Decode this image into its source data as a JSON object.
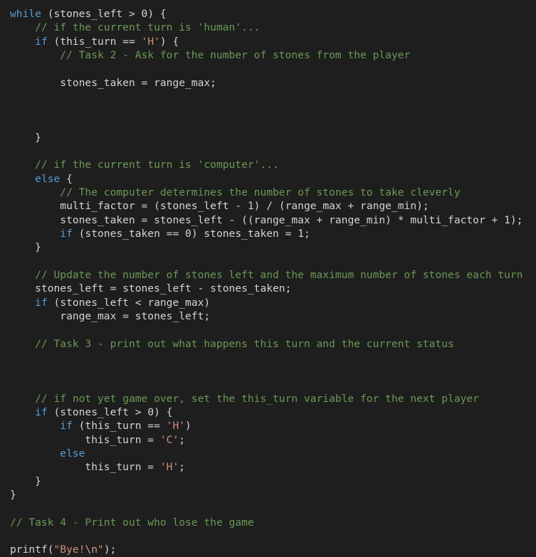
{
  "editor": {
    "language": "c",
    "theme": "dark-plus",
    "background_color": "#1e1e1e",
    "default_text_color": "#d4d4d4",
    "keyword_color": "#569cd6",
    "comment_color": "#6a9955",
    "string_color": "#ce9178",
    "escape_color": "#d7a58e",
    "font_size_px": 14.6,
    "line_height_px": 19.32,
    "indent_spaces": 4
  },
  "lines": [
    {
      "n": 1,
      "tokens": [
        {
          "t": "key",
          "s": "while"
        },
        {
          "t": "def",
          "s": " (stones_left > "
        },
        {
          "t": "num",
          "s": "0"
        },
        {
          "t": "def",
          "s": ") {"
        }
      ]
    },
    {
      "n": 2,
      "tokens": [
        {
          "t": "com",
          "s": "    // if the current turn is 'human'..."
        }
      ]
    },
    {
      "n": 3,
      "tokens": [
        {
          "t": "def",
          "s": "    "
        },
        {
          "t": "key",
          "s": "if"
        },
        {
          "t": "def",
          "s": " (this_turn == "
        },
        {
          "t": "str",
          "s": "'H'"
        },
        {
          "t": "def",
          "s": ") {"
        }
      ]
    },
    {
      "n": 4,
      "tokens": [
        {
          "t": "com",
          "s": "        // Task 2 - Ask for the number of stones from the player"
        }
      ]
    },
    {
      "n": 5,
      "tokens": []
    },
    {
      "n": 6,
      "tokens": [
        {
          "t": "def",
          "s": "        stones_taken = range_max;"
        }
      ]
    },
    {
      "n": 7,
      "tokens": []
    },
    {
      "n": 8,
      "tokens": []
    },
    {
      "n": 9,
      "tokens": []
    },
    {
      "n": 10,
      "tokens": [
        {
          "t": "def",
          "s": "    }"
        }
      ]
    },
    {
      "n": 11,
      "tokens": []
    },
    {
      "n": 12,
      "tokens": [
        {
          "t": "com",
          "s": "    // if the current turn is 'computer'..."
        }
      ]
    },
    {
      "n": 13,
      "tokens": [
        {
          "t": "def",
          "s": "    "
        },
        {
          "t": "key",
          "s": "else"
        },
        {
          "t": "def",
          "s": " {"
        }
      ]
    },
    {
      "n": 14,
      "tokens": [
        {
          "t": "com",
          "s": "        // The computer determines the number of stones to take cleverly"
        }
      ]
    },
    {
      "n": 15,
      "tokens": [
        {
          "t": "def",
          "s": "        multi_factor = (stones_left - "
        },
        {
          "t": "num",
          "s": "1"
        },
        {
          "t": "def",
          "s": ") / (range_max + range_min);"
        }
      ]
    },
    {
      "n": 16,
      "tokens": [
        {
          "t": "def",
          "s": "        stones_taken = stones_left - ((range_max + range_min) * multi_factor + "
        },
        {
          "t": "num",
          "s": "1"
        },
        {
          "t": "def",
          "s": ");"
        }
      ]
    },
    {
      "n": 17,
      "tokens": [
        {
          "t": "def",
          "s": "        "
        },
        {
          "t": "key",
          "s": "if"
        },
        {
          "t": "def",
          "s": " (stones_taken == "
        },
        {
          "t": "num",
          "s": "0"
        },
        {
          "t": "def",
          "s": ") stones_taken = "
        },
        {
          "t": "num",
          "s": "1"
        },
        {
          "t": "def",
          "s": ";"
        }
      ]
    },
    {
      "n": 18,
      "tokens": [
        {
          "t": "def",
          "s": "    }"
        }
      ]
    },
    {
      "n": 19,
      "tokens": []
    },
    {
      "n": 20,
      "tokens": [
        {
          "t": "com",
          "s": "    // Update the number of stones left and the maximum number of stones each turn"
        }
      ]
    },
    {
      "n": 21,
      "tokens": [
        {
          "t": "def",
          "s": "    stones_left = stones_left - stones_taken;"
        }
      ]
    },
    {
      "n": 22,
      "tokens": [
        {
          "t": "def",
          "s": "    "
        },
        {
          "t": "key",
          "s": "if"
        },
        {
          "t": "def",
          "s": " (stones_left < range_max)"
        }
      ]
    },
    {
      "n": 23,
      "tokens": [
        {
          "t": "def",
          "s": "        range_max = stones_left;"
        }
      ]
    },
    {
      "n": 24,
      "tokens": []
    },
    {
      "n": 25,
      "tokens": [
        {
          "t": "com",
          "s": "    // Task 3 - print out what happens this turn and the current status"
        }
      ]
    },
    {
      "n": 26,
      "tokens": []
    },
    {
      "n": 27,
      "tokens": []
    },
    {
      "n": 28,
      "tokens": []
    },
    {
      "n": 29,
      "tokens": [
        {
          "t": "com",
          "s": "    // if not yet game over, set the this_turn variable for the next player"
        }
      ]
    },
    {
      "n": 30,
      "tokens": [
        {
          "t": "def",
          "s": "    "
        },
        {
          "t": "key",
          "s": "if"
        },
        {
          "t": "def",
          "s": " (stones_left > "
        },
        {
          "t": "num",
          "s": "0"
        },
        {
          "t": "def",
          "s": ") {"
        }
      ]
    },
    {
      "n": 31,
      "tokens": [
        {
          "t": "def",
          "s": "        "
        },
        {
          "t": "key",
          "s": "if"
        },
        {
          "t": "def",
          "s": " (this_turn == "
        },
        {
          "t": "str",
          "s": "'H'"
        },
        {
          "t": "def",
          "s": ")"
        }
      ]
    },
    {
      "n": 32,
      "tokens": [
        {
          "t": "def",
          "s": "            this_turn = "
        },
        {
          "t": "str",
          "s": "'C'"
        },
        {
          "t": "def",
          "s": ";"
        }
      ]
    },
    {
      "n": 33,
      "tokens": [
        {
          "t": "def",
          "s": "        "
        },
        {
          "t": "key",
          "s": "else"
        }
      ]
    },
    {
      "n": 34,
      "tokens": [
        {
          "t": "def",
          "s": "            this_turn = "
        },
        {
          "t": "str",
          "s": "'H'"
        },
        {
          "t": "def",
          "s": ";"
        }
      ]
    },
    {
      "n": 35,
      "tokens": [
        {
          "t": "def",
          "s": "    }"
        }
      ]
    },
    {
      "n": 36,
      "tokens": [
        {
          "t": "def",
          "s": "}"
        }
      ]
    },
    {
      "n": 37,
      "tokens": []
    },
    {
      "n": 38,
      "tokens": [
        {
          "t": "com",
          "s": "// Task 4 - Print out who lose the game"
        }
      ]
    },
    {
      "n": 39,
      "tokens": []
    },
    {
      "n": 40,
      "tokens": [
        {
          "t": "def",
          "s": "printf("
        },
        {
          "t": "str",
          "s": "\"Bye!"
        },
        {
          "t": "esc",
          "s": "\\n"
        },
        {
          "t": "str",
          "s": "\""
        },
        {
          "t": "def",
          "s": ");"
        }
      ]
    }
  ]
}
